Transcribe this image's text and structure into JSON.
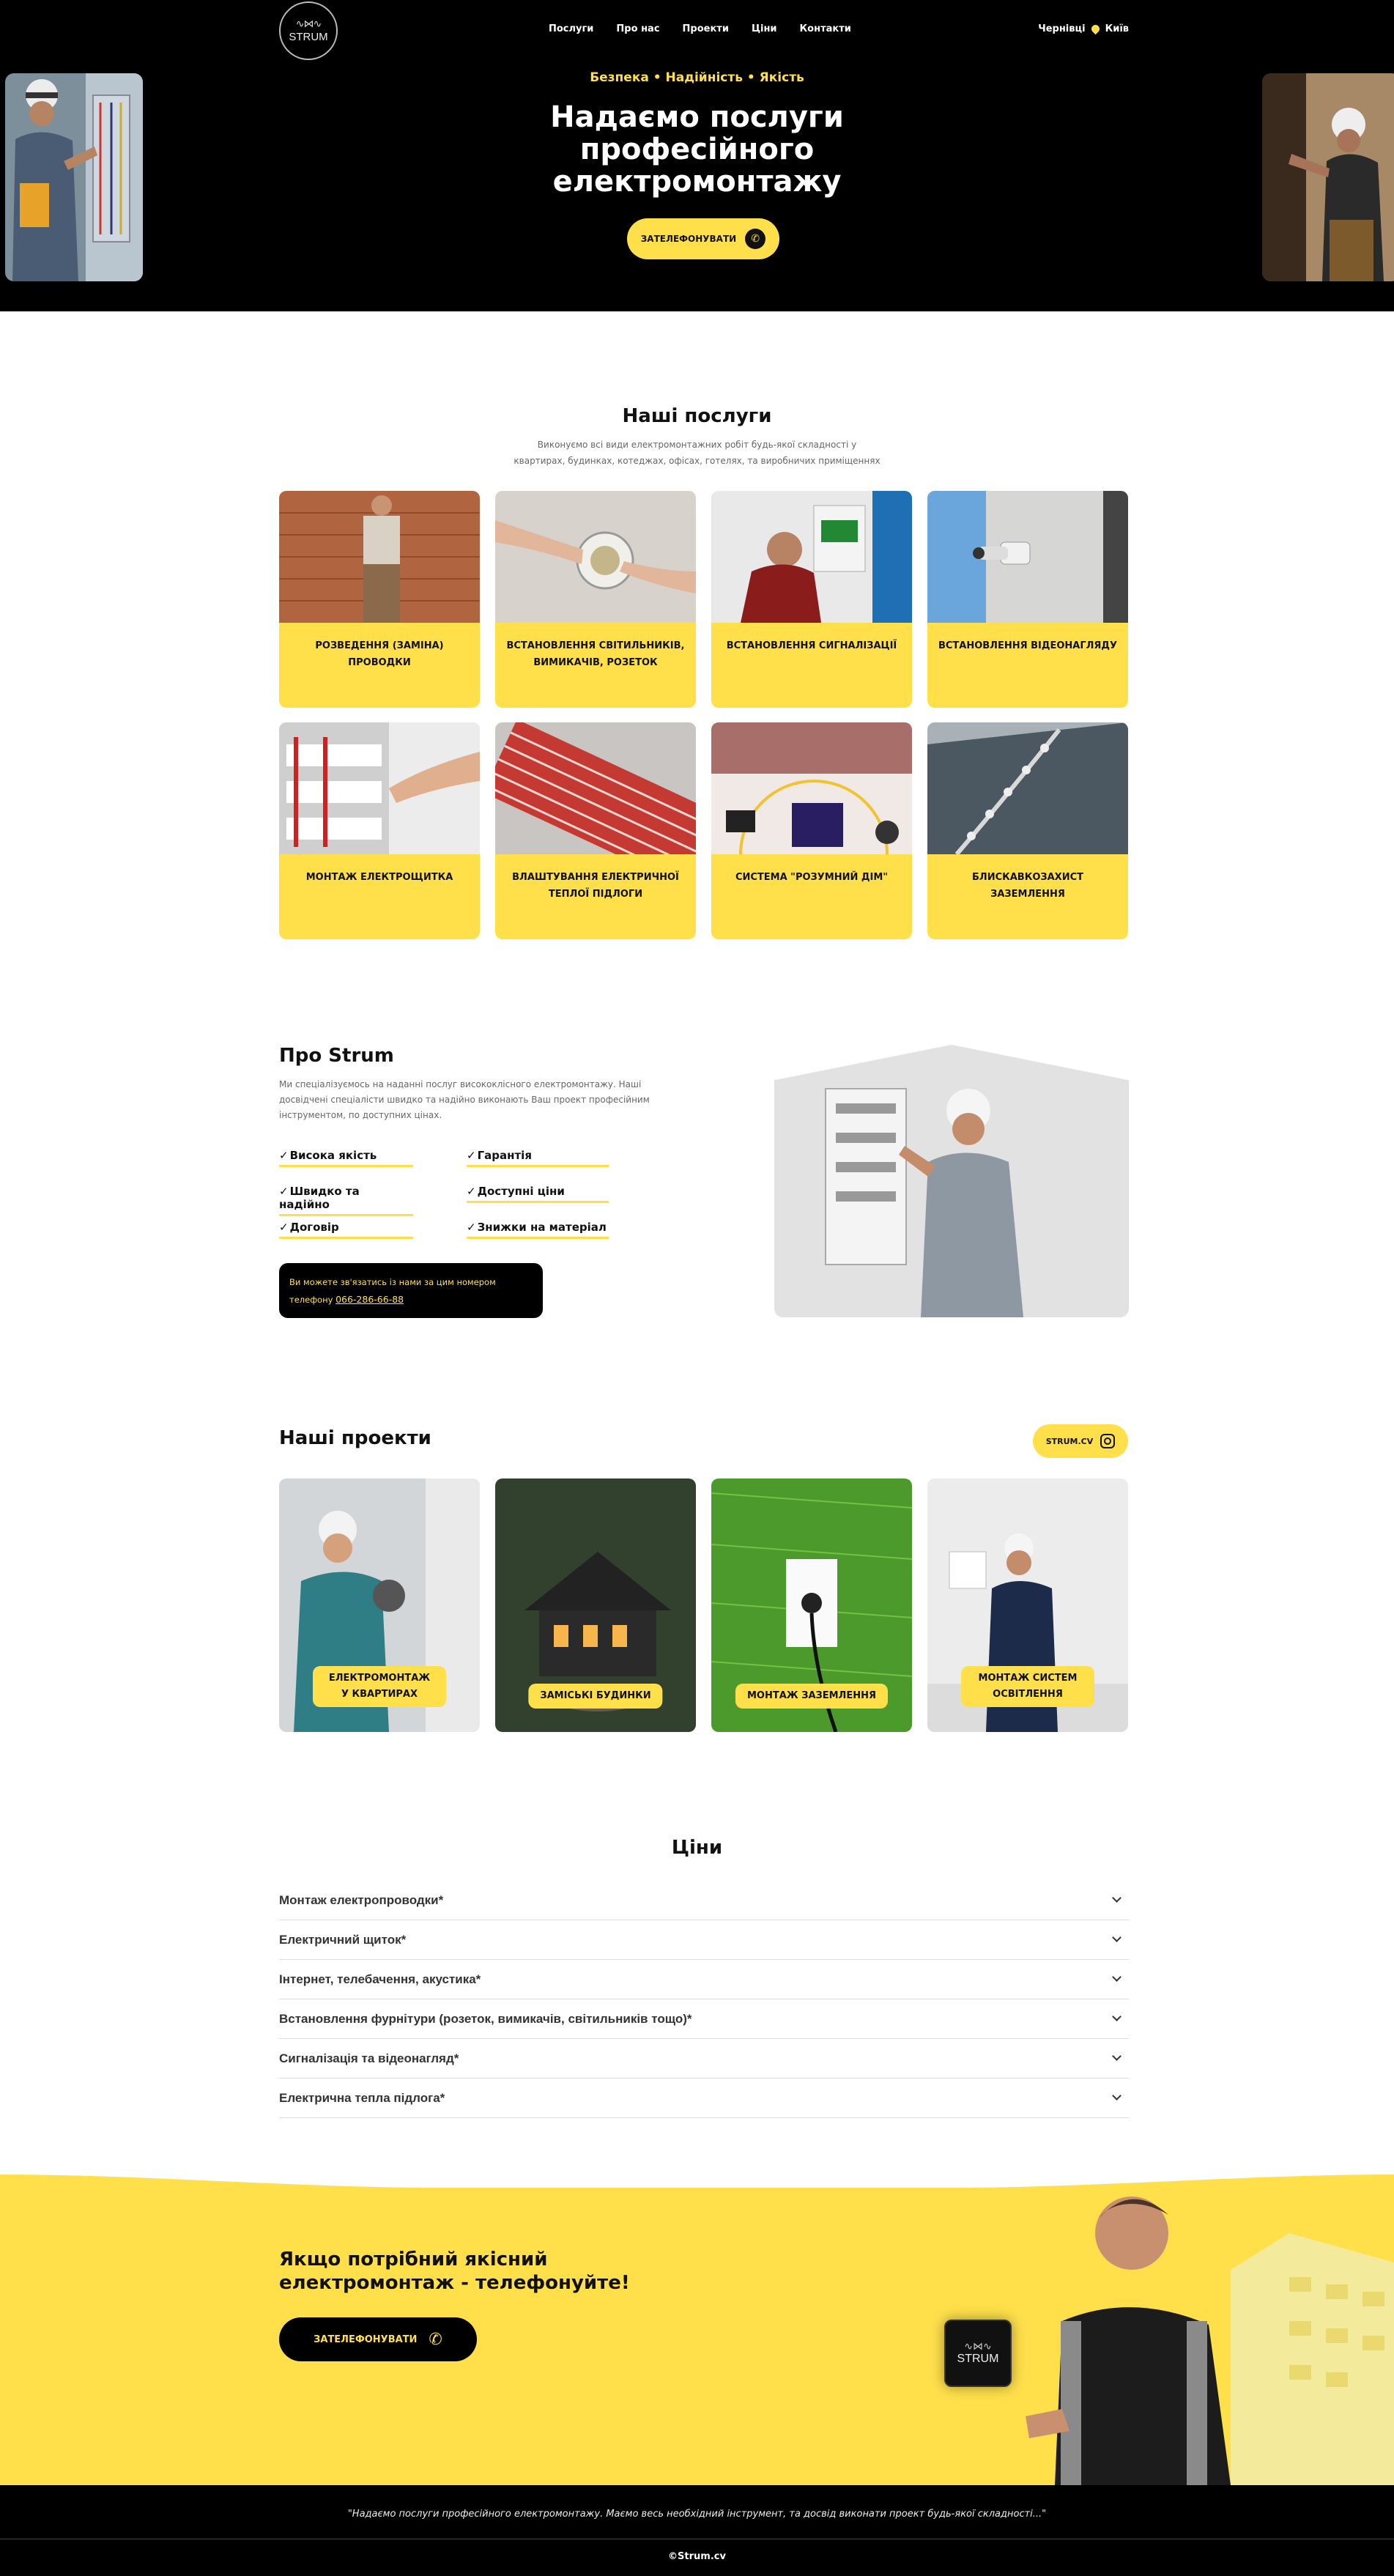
{
  "header": {
    "logo_text": "STRUM",
    "nav": [
      "Послуги",
      "Про нас",
      "Проекти",
      "Ціни",
      "Контакти"
    ],
    "city_left": "Чернівці",
    "city_right": "Київ"
  },
  "hero": {
    "tagline": "Безпека • Надійність • Якість",
    "title_line1": "Надаємо послуги",
    "title_line2": "професійного",
    "title_line3": "електромонтажу",
    "cta_label": "ЗАТЕЛЕФОНУВАТИ"
  },
  "services": {
    "title": "Наші послуги",
    "subtitle_line1": "Виконуємо всі види електромонтажних робіт будь-якої складності у",
    "subtitle_line2": "квартирах, будинках, котеджах, офісах, готелях, та виробничих приміщеннях",
    "items": [
      "РОЗВЕДЕННЯ (ЗАМІНА) ПРОВОДКИ",
      "ВСТАНОВЛЕННЯ СВІТИЛЬНИКІВ, ВИМИКАЧІВ, РОЗЕТОК",
      "ВСТАНОВЛЕННЯ СИГНАЛІЗАЦІЇ",
      "ВСТАНОВЛЕННЯ ВІДЕОНАГЛЯДУ",
      "МОНТАЖ ЕЛЕКТРОЩИТКА",
      "ВЛАШТУВАННЯ ЕЛЕКТРИЧНОЇ ТЕПЛОЇ ПІДЛОГИ",
      "СИСТЕМА \"РОЗУМНИЙ ДІМ\"",
      "БЛИСКАВКОЗАХИСТ ЗАЗЕМЛЕННЯ"
    ]
  },
  "about": {
    "title": "Про Strum",
    "text": "Ми спеціалізуємось на наданні послуг висококлісного електромонтажу. Наші досвідчені спеціалісти швидко та надійно виконають Ваш проект професійним інструментом, по доступних цінах.",
    "features": [
      "Висока якість",
      "Гарантія",
      "Швидко та надійно",
      "Доступні ціни",
      "Договір",
      "Знижки на матеріал"
    ],
    "contact_text": "Ви можете зв'язатись із нами за цим номером телефону",
    "phone": "066-286-66-88"
  },
  "projects": {
    "title": "Наші проекти",
    "instagram": "STRUM.CV",
    "items": [
      "ЕЛЕКТРОМОНТАЖ У КВАРТИРАХ",
      "ЗАМІСЬКІ БУДИНКИ",
      "МОНТАЖ ЗАЗЕМЛЕННЯ",
      "МОНТАЖ СИСТЕМ ОСВІТЛЕННЯ"
    ]
  },
  "prices": {
    "title": "Ціни",
    "items": [
      "Монтаж електропроводки*",
      "Електричний щиток*",
      "Інтернет, телебачення, акустика*",
      "Встановлення фурнітури (розеток, вимикачів, світильників тощо)*",
      "Сигналізація та відеонагляд*",
      "Електрична тепла підлога*"
    ]
  },
  "cta": {
    "title_line1": "Якщо потрібний якісний",
    "title_line2": "електромонтаж - телефонуйте!",
    "button": "ЗАТЕЛЕФОНУВАТИ",
    "sign_text": "STRUM"
  },
  "footer": {
    "quote": "\"Надаємо послуги професійного електромонтажу. Маємо весь необхідний інструмент, та досвід виконати проект будь-якої складності...\"",
    "copyright": "©Strum.cv"
  },
  "colors": {
    "accent": "#ffe04b",
    "dark": "#000000"
  }
}
